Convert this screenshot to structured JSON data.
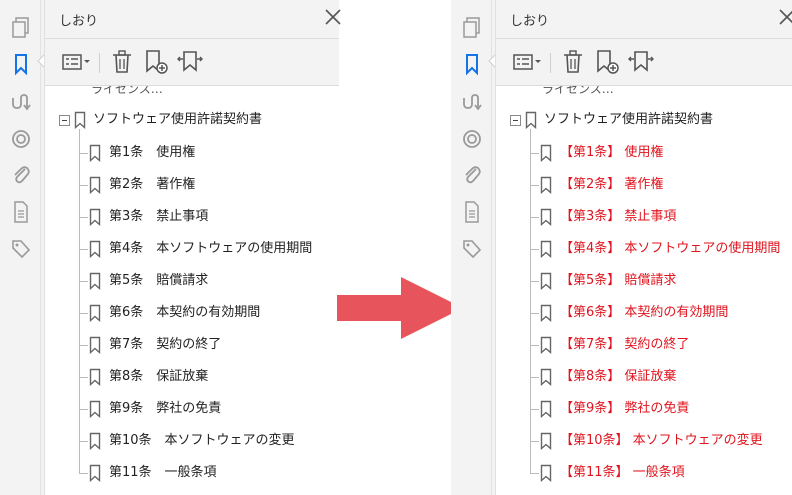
{
  "panel_title": "しおり",
  "root_bookmark": "ソフトウェア使用許諾契約書",
  "truncated_bookmark": "ライセンス…",
  "left_panel": {
    "items": [
      "第1条　使用権",
      "第2条　著作権",
      "第3条　禁止事項",
      "第4条　本ソフトウェアの使用期間",
      "第5条　賠償請求",
      "第6条　本契約の有効期間",
      "第7条　契約の終了",
      "第8条　保証放棄",
      "第9条　弊社の免責",
      "第10条　本ソフトウェアの変更",
      "第11条　一般条項"
    ]
  },
  "right_panel": {
    "items": [
      "【第1条】 使用権",
      "【第2条】 著作権",
      "【第3条】 禁止事項",
      "【第4条】 本ソフトウェアの使用期間",
      "【第5条】 賠償請求",
      "【第6条】 本契約の有効期間",
      "【第7条】 契約の終了",
      "【第8条】 保証放棄",
      "【第9条】 弊社の免責",
      "【第10条】 本ソフトウェアの変更",
      "【第11条】 一般条項"
    ]
  },
  "colors": {
    "normal_text": "#222222",
    "highlight_text": "#e0141e",
    "arrow": "#e8545b",
    "active_icon": "#1473e6",
    "icon_gray": "#9a9a9a"
  },
  "icons": [
    "pages-icon",
    "bookmark-icon",
    "signature-icon",
    "target-icon",
    "attachment-icon",
    "document-icon",
    "tag-icon",
    "options-icon",
    "delete-icon",
    "new-bookmark-icon",
    "expand-bookmark-icon",
    "close-icon"
  ]
}
